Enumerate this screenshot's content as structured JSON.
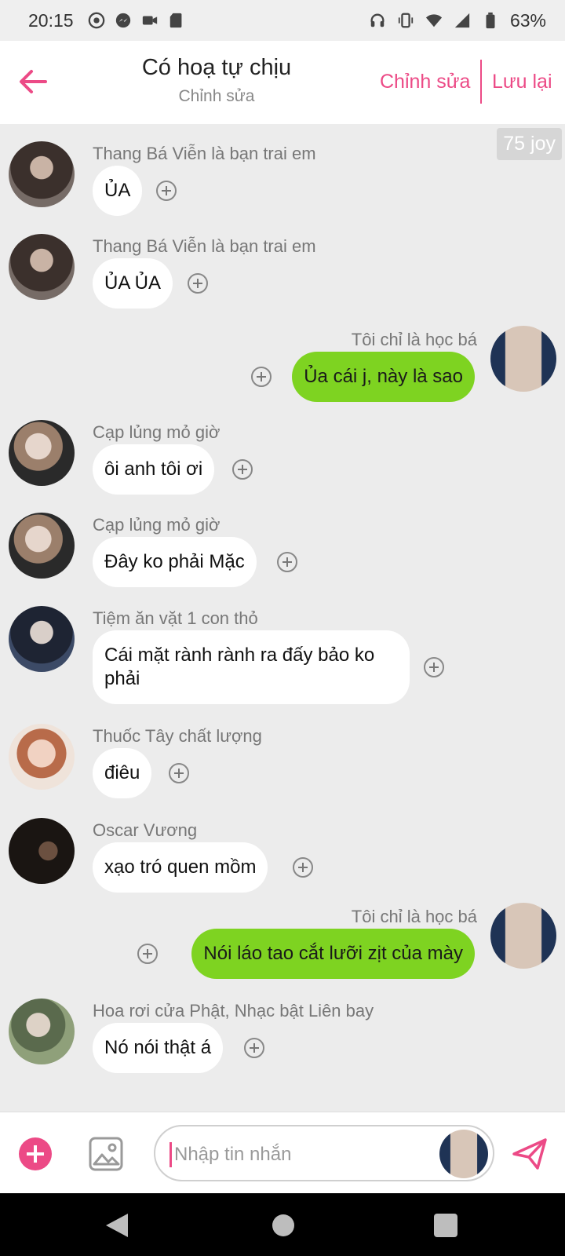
{
  "status_bar": {
    "time": "20:15",
    "battery": "63%",
    "left_icons": [
      "eye-icon",
      "messenger-icon",
      "video-icon",
      "sd-card-icon"
    ],
    "right_icons": [
      "headphones-icon",
      "vibrate-icon",
      "wifi-icon",
      "signal-icon",
      "battery-icon"
    ]
  },
  "header": {
    "title": "Có hoạ tự chịu",
    "subtitle": "Chỉnh sửa",
    "edit_label": "Chỉnh sửa",
    "save_label": "Lưu lại"
  },
  "joy_badge": "75 joy",
  "messages": [
    {
      "sender": "Thang Bá Viễn là bạn trai em",
      "text": "ỦA",
      "direction": "in"
    },
    {
      "sender": "Thang Bá Viễn là bạn trai em",
      "text": "ỦA ỦA",
      "direction": "in"
    },
    {
      "sender": "Tôi chỉ là học bá",
      "text": "Ủa cái j, này là sao",
      "direction": "out"
    },
    {
      "sender": "Cạp lủng mỏ giờ",
      "text": "ôi anh tôi ơi",
      "direction": "in"
    },
    {
      "sender": "Cạp lủng mỏ giờ",
      "text": "Đây ko phải Mặc",
      "direction": "in"
    },
    {
      "sender": "Tiệm ăn vặt 1 con thỏ",
      "text": "Cái mặt rành rành ra đấy bảo ko phải",
      "direction": "in"
    },
    {
      "sender": "Thuốc Tây chất lượng",
      "text": "điêu",
      "direction": "in"
    },
    {
      "sender": "Oscar Vương",
      "text": "xạo tró quen mồm",
      "direction": "in"
    },
    {
      "sender": "Tôi chỉ là học bá",
      "text": "Nói láo tao cắt lưỡi zịt của mày",
      "direction": "out"
    },
    {
      "sender": "Hoa rơi cửa Phật, Nhạc bật Liên bay",
      "text": "Nó nói thật á",
      "direction": "in"
    }
  ],
  "input": {
    "placeholder": "Nhập tin nhắn"
  },
  "colors": {
    "accent": "#ec4a86",
    "outgoing_bubble": "#7ed321",
    "incoming_bubble": "#ffffff",
    "chat_background": "#ececec"
  }
}
